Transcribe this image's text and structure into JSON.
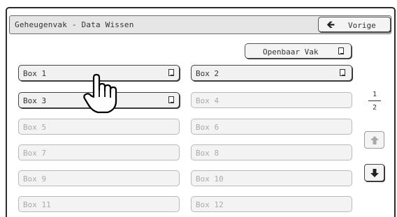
{
  "header": {
    "title": "Geheugenvak - Data Wissen",
    "back_label": "Vorige"
  },
  "public_button": {
    "label": "Openbaar Vak"
  },
  "boxes": [
    {
      "label": "Box 1",
      "active": true
    },
    {
      "label": "Box 2",
      "active": true
    },
    {
      "label": "Box 3",
      "active": true
    },
    {
      "label": "Box 4",
      "active": false
    },
    {
      "label": "Box 5",
      "active": false
    },
    {
      "label": "Box 6",
      "active": false
    },
    {
      "label": "Box 7",
      "active": false
    },
    {
      "label": "Box 8",
      "active": false
    },
    {
      "label": "Box 9",
      "active": false
    },
    {
      "label": "Box 10",
      "active": false
    },
    {
      "label": "Box 11",
      "active": false
    },
    {
      "label": "Box 12",
      "active": false
    }
  ],
  "pagination": {
    "current": "1",
    "total": "2"
  },
  "icons": {
    "back": "left-arrow-icon",
    "document": "document-icon",
    "up": "up-arrow-icon",
    "down": "down-arrow-icon",
    "pointer": "hand-pointer-icon"
  }
}
